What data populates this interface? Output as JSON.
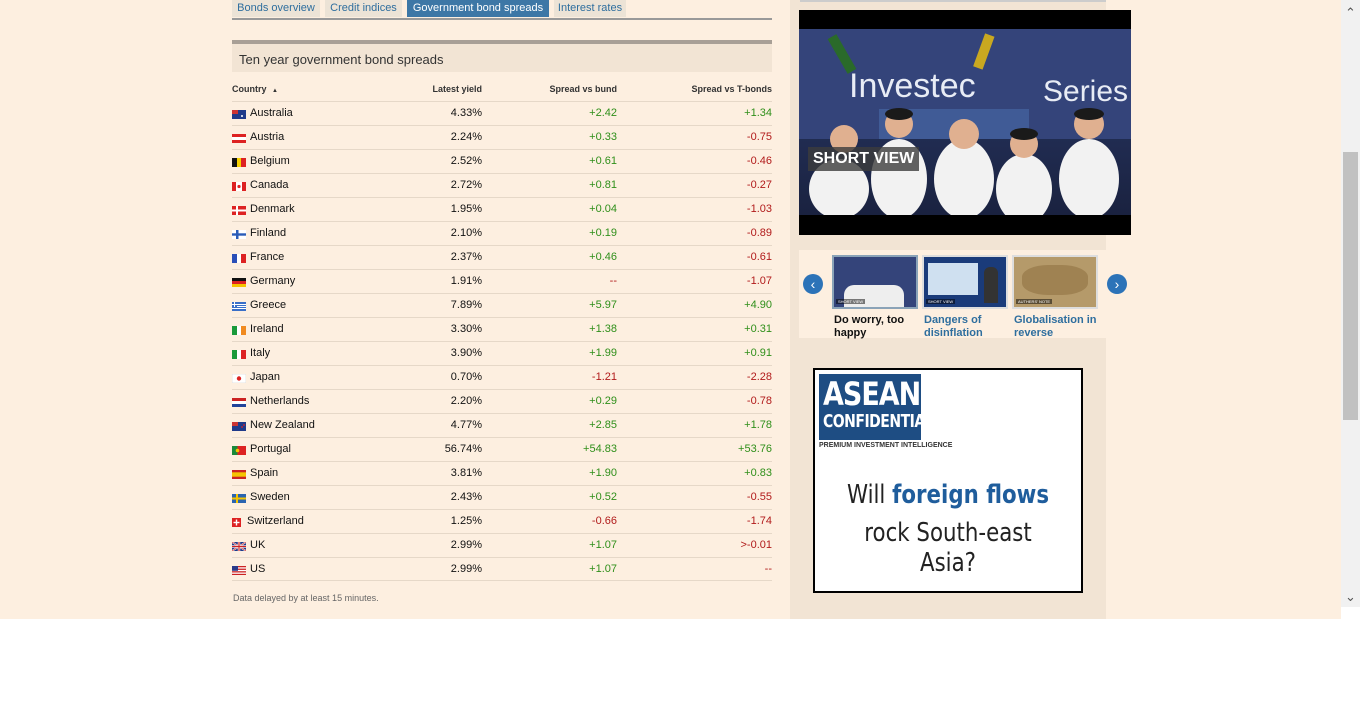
{
  "tabs": [
    {
      "label": "Bonds overview",
      "active": false
    },
    {
      "label": "Credit indices",
      "active": false
    },
    {
      "label": "Government bond spreads",
      "active": true
    },
    {
      "label": "Interest rates",
      "active": false
    }
  ],
  "table": {
    "title": "Ten year government bond spreads",
    "columns": {
      "country": "Country",
      "sort_indicator": "▲",
      "yield": "Latest yield",
      "bund": "Spread vs bund",
      "tbonds": "Spread vs T-bonds"
    },
    "rows": [
      {
        "country": "Australia",
        "flag": "australia-flag-icon",
        "yield": "4.33%",
        "bund": "+2.42",
        "tbonds": "+1.34"
      },
      {
        "country": "Austria",
        "flag": "austria-flag-icon",
        "yield": "2.24%",
        "bund": "+0.33",
        "tbonds": "-0.75"
      },
      {
        "country": "Belgium",
        "flag": "belgium-flag-icon",
        "yield": "2.52%",
        "bund": "+0.61",
        "tbonds": "-0.46"
      },
      {
        "country": "Canada",
        "flag": "canada-flag-icon",
        "yield": "2.72%",
        "bund": "+0.81",
        "tbonds": "-0.27"
      },
      {
        "country": "Denmark",
        "flag": "denmark-flag-icon",
        "yield": "1.95%",
        "bund": "+0.04",
        "tbonds": "-1.03"
      },
      {
        "country": "Finland",
        "flag": "finland-flag-icon",
        "yield": "2.10%",
        "bund": "+0.19",
        "tbonds": "-0.89"
      },
      {
        "country": "France",
        "flag": "france-flag-icon",
        "yield": "2.37%",
        "bund": "+0.46",
        "tbonds": "-0.61"
      },
      {
        "country": "Germany",
        "flag": "germany-flag-icon",
        "yield": "1.91%",
        "bund": "--",
        "tbonds": "-1.07"
      },
      {
        "country": "Greece",
        "flag": "greece-flag-icon",
        "yield": "7.89%",
        "bund": "+5.97",
        "tbonds": "+4.90"
      },
      {
        "country": "Ireland",
        "flag": "ireland-flag-icon",
        "yield": "3.30%",
        "bund": "+1.38",
        "tbonds": "+0.31"
      },
      {
        "country": "Italy",
        "flag": "italy-flag-icon",
        "yield": "3.90%",
        "bund": "+1.99",
        "tbonds": "+0.91"
      },
      {
        "country": "Japan",
        "flag": "japan-flag-icon",
        "yield": "0.70%",
        "bund": "-1.21",
        "tbonds": "-2.28"
      },
      {
        "country": "Netherlands",
        "flag": "netherlands-flag-icon",
        "yield": "2.20%",
        "bund": "+0.29",
        "tbonds": "-0.78"
      },
      {
        "country": "New Zealand",
        "flag": "new-zealand-flag-icon",
        "yield": "4.77%",
        "bund": "+2.85",
        "tbonds": "+1.78"
      },
      {
        "country": "Portugal",
        "flag": "portugal-flag-icon",
        "yield": "56.74%",
        "bund": "+54.83",
        "tbonds": "+53.76"
      },
      {
        "country": "Spain",
        "flag": "spain-flag-icon",
        "yield": "3.81%",
        "bund": "+1.90",
        "tbonds": "+0.83"
      },
      {
        "country": "Sweden",
        "flag": "sweden-flag-icon",
        "yield": "2.43%",
        "bund": "+0.52",
        "tbonds": "-0.55"
      },
      {
        "country": "Switzerland",
        "flag": "switzerland-flag-icon",
        "yield": "1.25%",
        "bund": "-0.66",
        "tbonds": "-1.74"
      },
      {
        "country": "UK",
        "flag": "uk-flag-icon",
        "yield": "2.99%",
        "bund": "+1.07",
        "tbonds": ">-0.01"
      },
      {
        "country": "US",
        "flag": "us-flag-icon",
        "yield": "2.99%",
        "bund": "+1.07",
        "tbonds": "--"
      }
    ],
    "footnote": "Data delayed by at least 15 minutes."
  },
  "video": {
    "banner_text_1": "Investec",
    "banner_text_2": "Series",
    "label": "SHORT VIEW"
  },
  "carousel": {
    "prev_icon": "chevron-left-icon",
    "next_icon": "chevron-right-icon",
    "items": [
      {
        "caption": "Do worry, too happy",
        "badge": "SHORT VIEW",
        "selected": true
      },
      {
        "caption": "Dangers of disinflation",
        "badge": "SHORT VIEW",
        "selected": false
      },
      {
        "caption": "Globalisation in reverse",
        "badge": "AUTHERS' NOTE",
        "selected": false
      }
    ]
  },
  "ad": {
    "logo_line1": "ASEAN",
    "logo_line2": "CONFIDENTIAL",
    "tagline": "PREMIUM INVESTMENT INTELLIGENCE",
    "headline_a": "Will ",
    "headline_b": "foreign flows",
    "headline_c": "rock South-east Asia?"
  },
  "colors": {
    "positive": "#2f8f1a",
    "negative": "#b11a1a",
    "tab_active": "#3d77a6",
    "page_bg": "#fdefe0"
  }
}
